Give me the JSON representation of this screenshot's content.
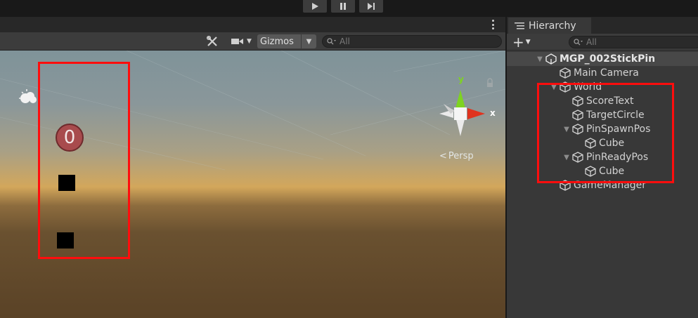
{
  "play_controls": [
    "play",
    "pause",
    "step"
  ],
  "scene_toolbar": {
    "gizmos_label": "Gizmos",
    "search_placeholder": "All"
  },
  "scene_view": {
    "score_value": "0",
    "persp_label": "Persp",
    "axis_y": "y",
    "axis_x": "x"
  },
  "hierarchy": {
    "tab_label": "Hierarchy",
    "search_placeholder": "All",
    "scene_name": "MGP_002StickPin",
    "items": [
      {
        "label": "Main Camera",
        "depth": 1
      },
      {
        "label": "World",
        "depth": 1,
        "expanded": true
      },
      {
        "label": "ScoreText",
        "depth": 2
      },
      {
        "label": "TargetCircle",
        "depth": 2
      },
      {
        "label": "PinSpawnPos",
        "depth": 2,
        "expanded": true
      },
      {
        "label": "Cube",
        "depth": 3
      },
      {
        "label": "PinReadyPos",
        "depth": 2,
        "expanded": true
      },
      {
        "label": "Cube",
        "depth": 3
      },
      {
        "label": "GameManager",
        "depth": 1
      }
    ]
  },
  "colors": {
    "highlight_box": "#ff0d0d",
    "gizmo_x": "#e0331e",
    "gizmo_y": "#7ed321",
    "score_fill": "#a84b4d"
  }
}
